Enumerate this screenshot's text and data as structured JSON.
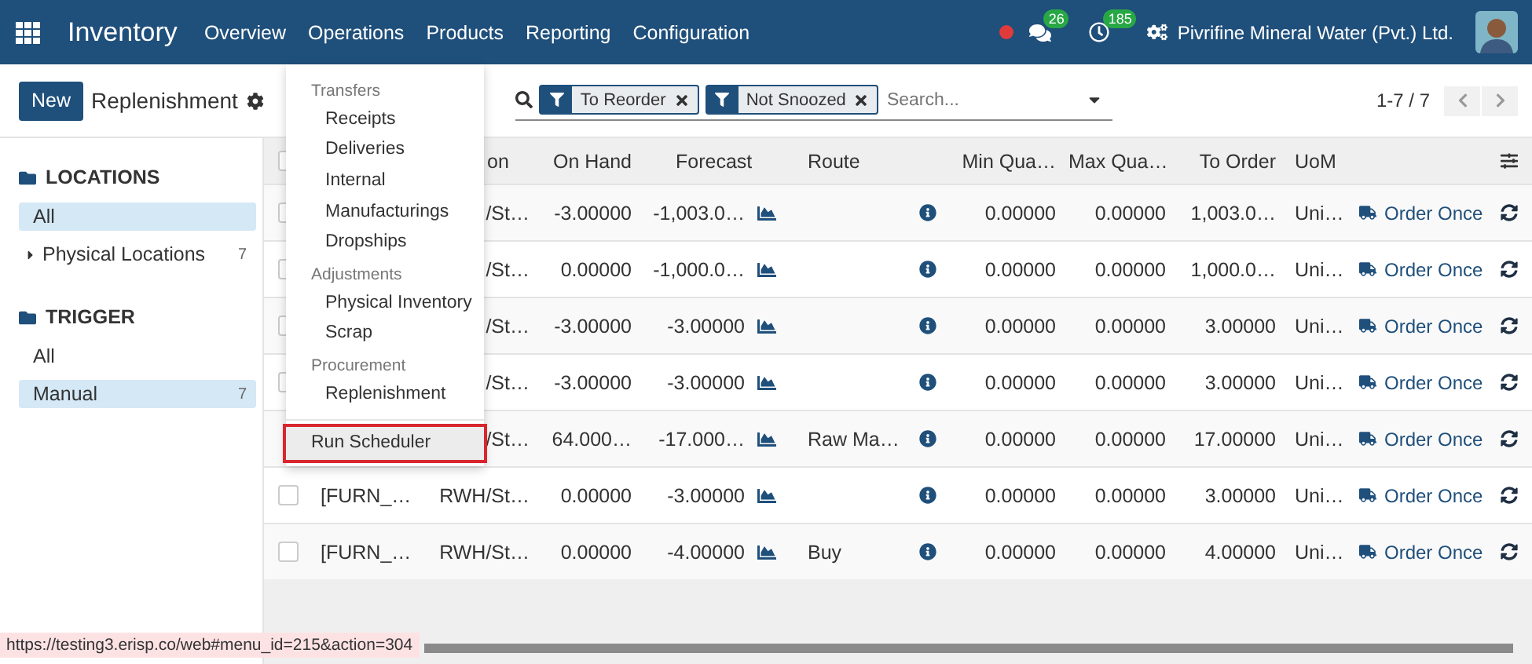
{
  "topbar": {
    "app_name": "Inventory",
    "menu": [
      {
        "label": "Overview"
      },
      {
        "label": "Operations"
      },
      {
        "label": "Products"
      },
      {
        "label": "Reporting"
      },
      {
        "label": "Configuration"
      }
    ],
    "messages_badge": "26",
    "activities_badge": "185",
    "company": "Pivrifine Mineral Water (Pvt.) Ltd."
  },
  "control_panel": {
    "new_button": "New",
    "title": "Replenishment",
    "facets": [
      {
        "label": "To Reorder"
      },
      {
        "label": "Not Snoozed"
      }
    ],
    "search": {
      "placeholder": "Search..."
    },
    "pager": "1-7 / 7"
  },
  "sidebar": {
    "sections": [
      {
        "title": "LOCATIONS",
        "items": [
          {
            "label": "All",
            "selected": true
          },
          {
            "label": "Physical Locations",
            "count": "7",
            "selected": false,
            "expanded": false
          }
        ]
      },
      {
        "title": "TRIGGER",
        "items": [
          {
            "label": "All",
            "selected": false
          },
          {
            "label": "Manual",
            "count": "7",
            "selected": true
          }
        ]
      }
    ]
  },
  "table": {
    "header_checked": false,
    "columns": {
      "location": "on",
      "on_hand": "On Hand",
      "forecast": "Forecast",
      "route": "Route",
      "min": "Min Qua…",
      "max": "Max Qua…",
      "to_order": "To Order",
      "uom": "UoM"
    },
    "rows": [
      {
        "checked": false,
        "location": "/St…",
        "on_hand": "-3.00000",
        "forecast": "-1,003.0…",
        "min": "0.00000",
        "max": "0.00000",
        "to_order": "1,003.0…",
        "uom": "Uni…",
        "action": "Order Once"
      },
      {
        "checked": false,
        "location": "/St…",
        "on_hand": "0.00000",
        "forecast": "-1,000.0…",
        "min": "0.00000",
        "max": "0.00000",
        "to_order": "1,000.0…",
        "uom": "Uni…",
        "action": "Order Once"
      },
      {
        "checked": false,
        "location": "/St…",
        "on_hand": "-3.00000",
        "forecast": "-3.00000",
        "min": "0.00000",
        "max": "0.00000",
        "to_order": "3.00000",
        "uom": "Uni…",
        "action": "Order Once"
      },
      {
        "checked": false,
        "location": "/St…",
        "on_hand": "-3.00000",
        "forecast": "-3.00000",
        "min": "0.00000",
        "max": "0.00000",
        "to_order": "3.00000",
        "uom": "Uni…",
        "action": "Order Once"
      },
      {
        "location": "/St…",
        "on_hand": "64.000…",
        "forecast": "-17.000…",
        "route": "Raw Ma…",
        "min": "0.00000",
        "max": "0.00000",
        "to_order": "17.00000",
        "uom": "Uni…",
        "action": "Order Once"
      },
      {
        "checked": false,
        "product": "[FURN_…",
        "location": "RWH/St…",
        "on_hand": "0.00000",
        "forecast": "-3.00000",
        "min": "0.00000",
        "max": "0.00000",
        "to_order": "3.00000",
        "uom": "Uni…",
        "action": "Order Once"
      },
      {
        "checked": false,
        "product": "[FURN_…",
        "location": "RWH/St…",
        "on_hand": "0.00000",
        "forecast": "-4.00000",
        "route": "Buy",
        "min": "0.00000",
        "max": "0.00000",
        "to_order": "4.00000",
        "uom": "Uni…",
        "action": "Order Once"
      }
    ]
  },
  "operations_menu": {
    "sections": [
      {
        "title": "Transfers",
        "items": [
          {
            "label": "Receipts",
            "highlighted": false
          },
          {
            "label": "Deliveries",
            "highlighted": false
          },
          {
            "label": "Internal",
            "highlighted": false
          },
          {
            "label": "Manufacturings",
            "highlighted": false
          },
          {
            "label": "Dropships",
            "highlighted": false
          }
        ]
      },
      {
        "title": "Adjustments",
        "items": [
          {
            "label": "Physical Inventory",
            "highlighted": false
          },
          {
            "label": "Scrap",
            "highlighted": false
          }
        ]
      },
      {
        "title": "Procurement",
        "items": [
          {
            "label": "Replenishment",
            "highlighted": false
          }
        ]
      },
      {
        "items": [
          {
            "label": "Run Scheduler",
            "highlighted": true
          }
        ]
      }
    ]
  },
  "status_url": "https://testing3.erisp.co/web#menu_id=215&action=304"
}
